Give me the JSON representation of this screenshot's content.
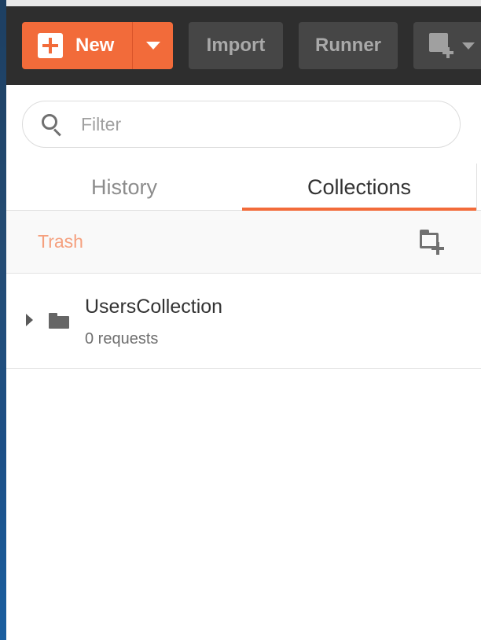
{
  "toolbar": {
    "new_label": "New",
    "import_label": "Import",
    "runner_label": "Runner"
  },
  "sidebar": {
    "filter": {
      "placeholder": "Filter",
      "value": ""
    },
    "tabs": [
      {
        "label": "History",
        "active": false
      },
      {
        "label": "Collections",
        "active": true
      }
    ],
    "trash_label": "Trash",
    "collections": [
      {
        "name": "UsersCollection",
        "meta": "0 requests"
      }
    ]
  },
  "colors": {
    "accent": "#f26b3a",
    "toolbar_bg": "#2e2e2e",
    "button_bg": "#464646"
  },
  "icons": [
    "plus-icon",
    "caret-down-icon",
    "new-window-icon",
    "search-icon",
    "new-collection-icon",
    "expand-caret-icon",
    "folder-icon"
  ]
}
